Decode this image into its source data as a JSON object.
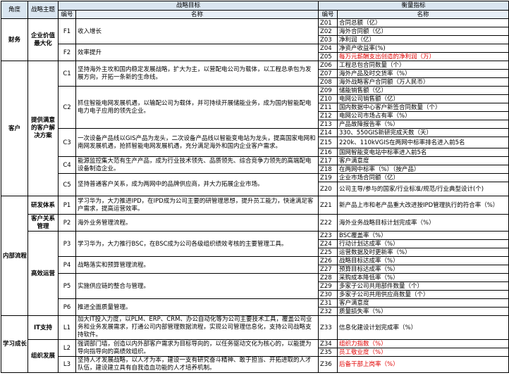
{
  "headers": {
    "dimension": "角度",
    "theme": "战略主题",
    "objective": "战略目标",
    "measure": "衡量指标",
    "obj_code": "编号",
    "obj_name": "名称",
    "m_code": "编号",
    "m_name": "名称"
  },
  "dimensions": {
    "finance": "财务",
    "customer": "客户",
    "internal": "内部流程",
    "learning": "学习成长"
  },
  "themes": {
    "t1": "企业价值最大化",
    "t2": "提供满意的客户解决方案",
    "t3": "研发体系",
    "t4": "客户关系管理",
    "t5": "高效运营",
    "t6": "IT支持",
    "t7": "组织发展"
  },
  "objectives": {
    "F1": {
      "code": "F1",
      "name": "收入增长"
    },
    "F2": {
      "code": "F2",
      "name": "效率提升"
    },
    "C1": {
      "code": "C1",
      "name": "坚持海外主攻和国内稳定发展战略，扩大为主，以营配电公司为载体，以工程总承包为发展方向，开拓一条新的生命线。"
    },
    "C2": {
      "code": "C2",
      "name": "抓住智能电网发展机遇，以输配公司为载体，并可持续开展储能业务，成为国内智能配电电力电子应用的领先企业。"
    },
    "C3": {
      "code": "C3",
      "name": "一次设备产品线以GIS产品为龙头，二次设备产品线以智能变电站为龙头，提高国家电网和南网发展机遇，抢抓智能电网发展机遇，充分满足海外和国内企业客户需求。"
    },
    "C4": {
      "code": "C4",
      "name": "能源监控集大范有生产产品，成为行业技术领先、品质领先、综合竞争力领先的高端配电设备制造企业。"
    },
    "C5": {
      "code": "C5",
      "name": "坚持普通客户关系，成为两网中的品牌供应商，并大力拓展企业市场。"
    },
    "P1": {
      "code": "P1",
      "name": "学习华为，大力推进IPD，在IPD成为公司主要的研管理思想，提升员工能力，快速满足客户需求，提高运营效率。"
    },
    "P2": {
      "code": "P2",
      "name": "海外业务管理流程。"
    },
    "P3": {
      "code": "P3",
      "name": "学习华为，大力推行BSC，在BSC成为公司各级组织绩效考核的主要管理工具。"
    },
    "P4": {
      "code": "P4",
      "name": "战略落实和预算管理流程。"
    },
    "P5": {
      "code": "P5",
      "name": "实施供应链的整合与管理。"
    },
    "P6": {
      "code": "P6",
      "name": "推进全面质量管理。"
    },
    "L1": {
      "code": "L1",
      "name": "加大IT投入力度，以PLM、ERP、CRM、办公自动化等为公司主要技术工具，覆盖公司业务和业务发展需求，打通公司内部管理数据流程，实现公司管理信息化，支持公司战略支持软件。"
    },
    "L2": {
      "code": "L2",
      "name": "强调部门墙，创造以内外部客户需求为目标导向的，以任务驱动文化为核心的，以能提为导向指导向的高绩效组织。"
    },
    "L3": {
      "code": "L3",
      "name": "坚持人才发展战略，以人才为本，建设一支有研究奋斗精神、敢于担当、开拓进取的人才队伍，建设建立具有自我造血功能的人才培养机制。"
    }
  },
  "measures": [
    {
      "code": "Z01",
      "name": "合同总额（亿）",
      "red": false
    },
    {
      "code": "Z02",
      "name": "海外合同额（亿）",
      "red": false
    },
    {
      "code": "Z03",
      "name": "净利润（亿）",
      "red": false
    },
    {
      "code": "Z04",
      "name": "净资产收益率(%)",
      "red": false
    },
    {
      "code": "Z05",
      "name": "每万元薪酬支出创造的净利润（万）",
      "red": true
    },
    {
      "code": "Z06",
      "name": "工程总包合同数量（个）",
      "red": false
    },
    {
      "code": "Z07",
      "name": "海外产品及时交货率（%）",
      "red": false
    },
    {
      "code": "Z08",
      "name": "海外战略客户合同额（万人民币）",
      "red": false
    },
    {
      "code": "Z09",
      "name": "储能销售额（亿）",
      "red": false
    },
    {
      "code": "Z10",
      "name": "电网公司销售额（亿）",
      "red": false
    },
    {
      "code": "Z11",
      "name": "国内数据中心客户新签合同数量（个）",
      "red": false
    },
    {
      "code": "Z12",
      "name": "电网公司市场占有率（%）",
      "red": false
    },
    {
      "code": "Z13",
      "name": "产品故障报告率（%）",
      "red": false
    },
    {
      "code": "Z14",
      "name": "330、550GIS新研完成天数（天）",
      "red": false
    },
    {
      "code": "Z15",
      "name": "220k、110kVGIS在两网中标率排名进入前5名",
      "red": false
    },
    {
      "code": "Z16",
      "name": "国网智能变电站中标率进入前5名",
      "red": false
    },
    {
      "code": "Z17",
      "name": "客户满意度",
      "red": false
    },
    {
      "code": "Z18",
      "name": "在两网中标率（%）（按产品）",
      "red": false
    },
    {
      "code": "Z19",
      "name": "企业市场合同额（亿）",
      "red": false
    },
    {
      "code": "Z20",
      "name": "公司主导/参与的国家/行业标准/规范/行业典型设计(个)",
      "red": false
    },
    {
      "code": "Z21",
      "name": "新产品上市和老产品重大改进按IPD管理执行的符合率（%）",
      "red": false
    },
    {
      "code": "Z22",
      "name": "海外业务战略目标计划完成率（%）",
      "red": false
    },
    {
      "code": "Z23",
      "name": "BSC覆盖率（%）",
      "red": false
    },
    {
      "code": "Z24",
      "name": "行动计划达成率（%）",
      "red": false
    },
    {
      "code": "Z25",
      "name": "运营数据及时更新率（%）",
      "red": false
    },
    {
      "code": "Z26",
      "name": "战略目标达成率（%）",
      "red": false
    },
    {
      "code": "Z27",
      "name": "预算目标达成率（%）",
      "red": false
    },
    {
      "code": "Z28",
      "name": "采购成本降低率（%）",
      "red": false
    },
    {
      "code": "Z29",
      "name": "多家子公司共用部件数量（个）",
      "red": false
    },
    {
      "code": "Z30",
      "name": "多家子公司共用供应商数量（个）",
      "red": false
    },
    {
      "code": "Z31",
      "name": "客户满意度",
      "red": false
    },
    {
      "code": "Z32",
      "name": "质量损失率（%）",
      "red": false
    },
    {
      "code": "Z33",
      "name": "信息化建设计划完成率（%）",
      "red": false
    },
    {
      "code": "Z34",
      "name": "组织力指数（%）",
      "red": true
    },
    {
      "code": "Z35",
      "name": "员工敬业度（%）",
      "red": true
    },
    {
      "code": "Z36",
      "name": "后备干部上岗率（%）",
      "red": true
    }
  ]
}
